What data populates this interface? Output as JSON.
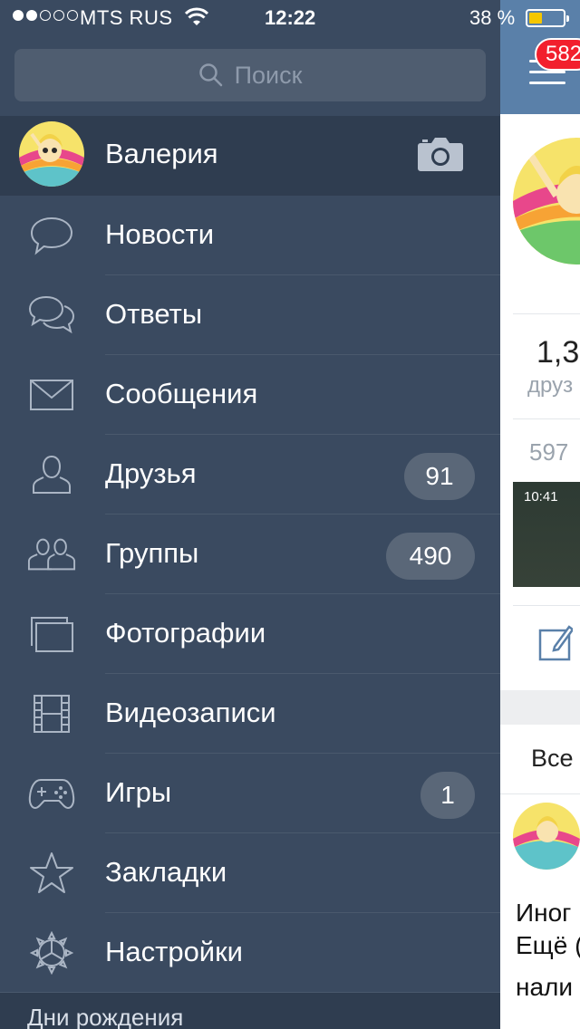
{
  "status_bar": {
    "carrier": "MTS RUS",
    "time": "12:22",
    "battery_percent": "38 %",
    "signal_bars_filled": 2,
    "signal_bars_total": 5,
    "battery_level": 0.38,
    "battery_color": "#f6c700"
  },
  "search": {
    "placeholder": "Поиск",
    "icon": "search-icon"
  },
  "profile": {
    "name": "Валерия",
    "camera_icon": "camera-icon"
  },
  "menu": {
    "items": [
      {
        "key": "news",
        "label": "Новости",
        "icon": "speech-bubble-icon",
        "badge": ""
      },
      {
        "key": "replies",
        "label": "Ответы",
        "icon": "double-bubble-icon",
        "badge": ""
      },
      {
        "key": "messages",
        "label": "Сообщения",
        "icon": "envelope-icon",
        "badge": ""
      },
      {
        "key": "friends",
        "label": "Друзья",
        "icon": "person-icon",
        "badge": "91"
      },
      {
        "key": "groups",
        "label": "Группы",
        "icon": "group-icon",
        "badge": "490"
      },
      {
        "key": "photos",
        "label": "Фотографии",
        "icon": "photos-icon",
        "badge": ""
      },
      {
        "key": "videos",
        "label": "Видеозаписи",
        "icon": "film-icon",
        "badge": ""
      },
      {
        "key": "games",
        "label": "Игры",
        "icon": "gamepad-icon",
        "badge": "1"
      },
      {
        "key": "bookmarks",
        "label": "Закладки",
        "icon": "star-icon",
        "badge": ""
      },
      {
        "key": "settings",
        "label": "Настройки",
        "icon": "gear-icon",
        "badge": ""
      }
    ],
    "birthdays_label": "Дни рождения"
  },
  "right_panel": {
    "notification_count": "582",
    "friends_count_partial": "1,3",
    "friends_label_partial": "друз",
    "photos_count_partial": "597",
    "thumb_time": "10:41",
    "tab_all_partial": "Все",
    "post_line1_partial": "Иног",
    "post_line2_partial": "Ещё (",
    "post_line3_partial": "нали"
  },
  "colors": {
    "menu_bg": "#3a4a60",
    "selected_bg": "#2f3d50",
    "badge_bg": "#5a6778",
    "header_blue": "#5a80a9",
    "notification_red": "#f21f2d"
  }
}
